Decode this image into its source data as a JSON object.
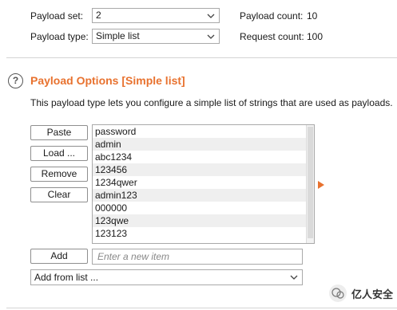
{
  "top": {
    "payload_set_label": "Payload set:",
    "payload_set_value": "2",
    "payload_type_label": "Payload type:",
    "payload_type_value": "Simple list",
    "payload_count_label": "Payload count:",
    "payload_count_value": "10",
    "request_count_label": "Request count:",
    "request_count_value": "100"
  },
  "section": {
    "help_icon_glyph": "?",
    "title": "Payload Options [Simple list]",
    "description": "This payload type lets you configure a simple list of strings that are used as payloads."
  },
  "buttons": {
    "paste": "Paste",
    "load": "Load ...",
    "remove": "Remove",
    "clear": "Clear",
    "add": "Add"
  },
  "list": {
    "items": [
      "password",
      "admin",
      "abc1234",
      "123456",
      "1234qwer",
      "admin123",
      "000000",
      "123qwe",
      "123123"
    ]
  },
  "new_item": {
    "placeholder": "Enter a new item",
    "value": ""
  },
  "add_from_list": {
    "value": "Add from list ..."
  },
  "watermark": {
    "text": "亿人安全"
  },
  "colors": {
    "accent": "#e8722f"
  }
}
